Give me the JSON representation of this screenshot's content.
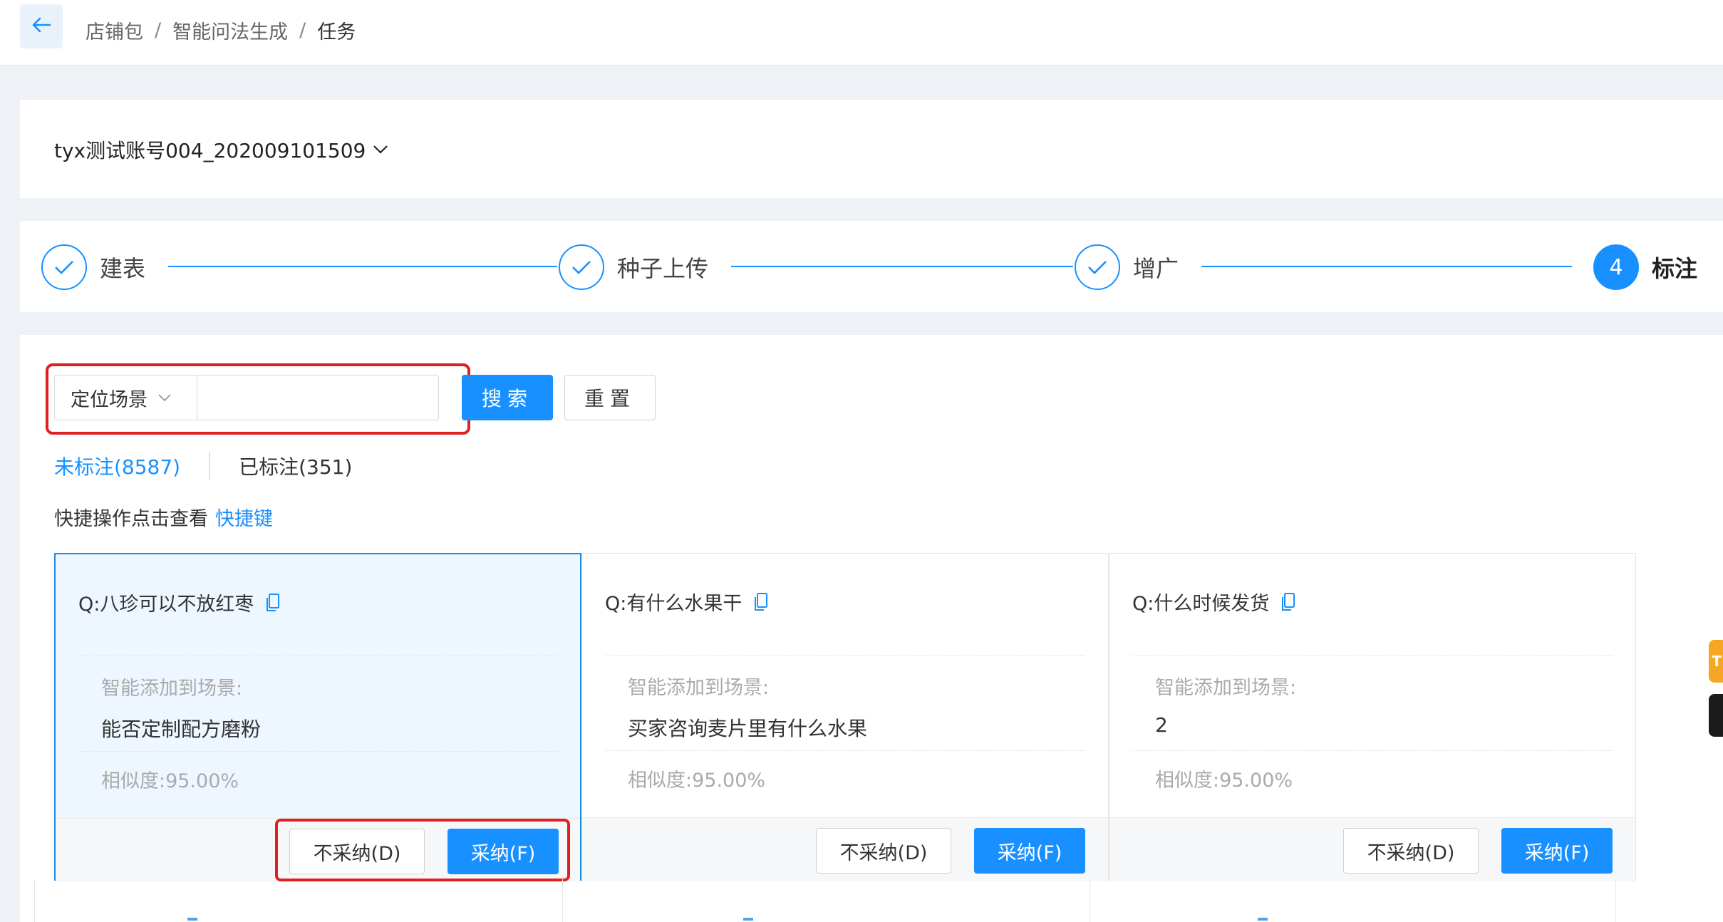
{
  "breadcrumb": {
    "items": [
      "店铺包",
      "智能问法生成",
      "任务"
    ],
    "separator": "/"
  },
  "account": {
    "selected": "tyx测试账号004_202009101509"
  },
  "steps": [
    {
      "label": "建表",
      "status": "done"
    },
    {
      "label": "种子上传",
      "status": "done"
    },
    {
      "label": "增广",
      "status": "done"
    },
    {
      "label": "标注",
      "status": "active",
      "number": "4"
    }
  ],
  "search": {
    "scene_select": "定位场景",
    "input_value": "",
    "search_label": "搜索",
    "reset_label": "重置"
  },
  "tabs": [
    {
      "label": "未标注(8587)",
      "active": true
    },
    {
      "label": "已标注(351)",
      "active": false
    }
  ],
  "shortcut": {
    "text": "快捷操作点击查看",
    "link": "快捷键"
  },
  "cards": [
    {
      "question": "Q:八珍可以不放红枣",
      "scene_label": "智能添加到场景:",
      "scene_value": "能否定制配方磨粉",
      "similarity": "相似度:95.00%",
      "reject_label": "不采纳(D)",
      "accept_label": "采纳(F)",
      "selected": true
    },
    {
      "question": "Q:有什么水果干",
      "scene_label": "智能添加到场景:",
      "scene_value": "买家咨询麦片里有什么水果",
      "similarity": "相似度:95.00%",
      "reject_label": "不采纳(D)",
      "accept_label": "采纳(F)",
      "selected": false
    },
    {
      "question": "Q:什么时候发货",
      "scene_label": "智能添加到场景:",
      "scene_value": "2",
      "similarity": "相似度:95.00%",
      "reject_label": "不采纳(D)",
      "accept_label": "采纳(F)",
      "selected": false
    }
  ],
  "float_tab": {
    "yellow_text": "T"
  },
  "colors": {
    "primary": "#1890ff",
    "highlight": "#e02020",
    "page_bg": "#eef1f5",
    "selected_card_bg": "#eef7ff"
  }
}
